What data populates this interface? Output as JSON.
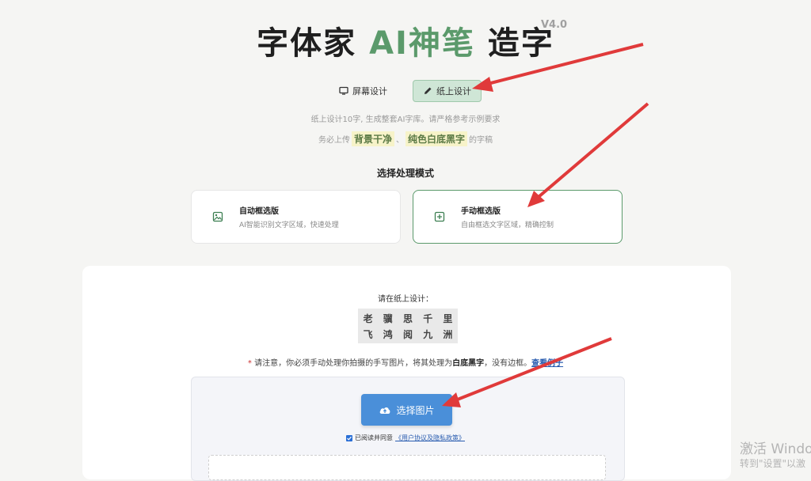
{
  "title": {
    "part1": "字体家 ",
    "ai": "AI神笔",
    "part2": " 造字"
  },
  "version": "V4.0",
  "tabs": [
    {
      "label": "屏幕设计",
      "icon": "monitor-icon",
      "active": false
    },
    {
      "label": "纸上设计",
      "icon": "pencil-icon",
      "active": true
    }
  ],
  "hint": {
    "line1": "纸上设计10字, 生成整套AI字库。请严格参考示例要求",
    "prefix": "务必上传",
    "hl1": "背景干净",
    "sep": "、",
    "hl2": "纯色白底黑字",
    "suffix": "的字稿"
  },
  "mode_section_title": "选择处理模式",
  "modes": [
    {
      "title": "自动框选版",
      "subtitle": "AI智能识别文字区域，快速处理",
      "icon": "image-icon",
      "selected": false
    },
    {
      "title": "手动框选版",
      "subtitle": "自由框选文字区域，精确控制",
      "icon": "plus-square-icon",
      "selected": true
    }
  ],
  "design_label": "请在纸上设计：",
  "design_chars": [
    "老",
    "骥",
    "思",
    "千",
    "里",
    "飞",
    "鸿",
    "阅",
    "九",
    "洲"
  ],
  "notice": {
    "star": "*",
    "text1": " 请注意，你必须手动处理你拍摄的手写图片，将其处理为",
    "bold": "白底黑字",
    "text2": "，没有边框。",
    "link": "查看例子"
  },
  "upload_button": "选择图片",
  "agreement": {
    "text": "已阅读并同意",
    "link": "《用户协议及隐私政策》",
    "checked": true
  },
  "watermark": {
    "line1": "激活 Windo",
    "line2": "转到\"设置\"以激"
  },
  "colors": {
    "accent_green": "#5b9a6b",
    "button_blue": "#4a8fd9",
    "arrow_red": "#e03a3a"
  }
}
